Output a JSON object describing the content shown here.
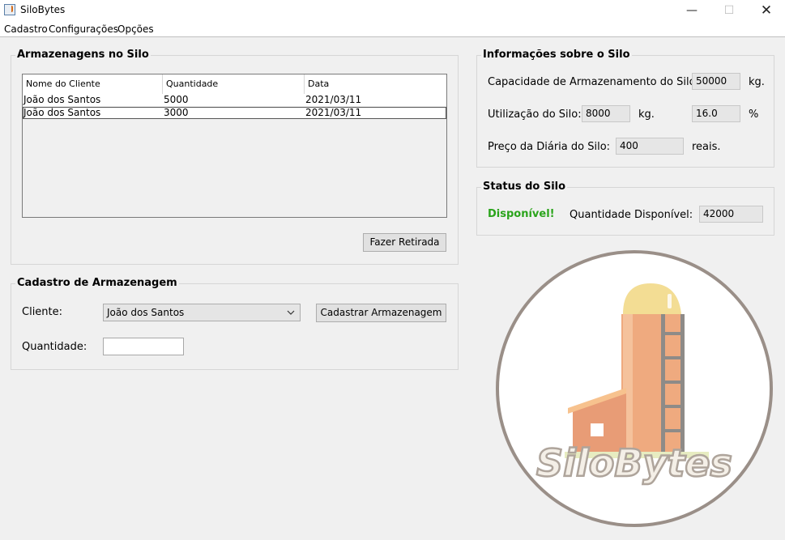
{
  "window": {
    "title": "SiloBytes",
    "minimize": "—",
    "maximize": "☐",
    "close": "✕"
  },
  "menu": [
    "Cadastro",
    "Configurações",
    "Opções"
  ],
  "storage_panel": {
    "title": "Armazenagens no Silo",
    "columns": [
      "Nome do Cliente",
      "Quantidade",
      "Data"
    ],
    "rows": [
      [
        "João dos Santos",
        "5000",
        "2021/03/11"
      ],
      [
        "João dos Santos",
        "3000",
        "2021/03/11"
      ]
    ],
    "withdraw_button": "Fazer Retirada"
  },
  "register_panel": {
    "title": "Cadastro de Armazenagem",
    "client_label": "Cliente:",
    "client_selected": "João dos Santos",
    "register_button": "Cadastrar Armazenagem",
    "quantity_label": "Quantidade:",
    "quantity_value": ""
  },
  "info_panel": {
    "title": "Informações sobre o Silo",
    "capacity_label": "Capacidade de Armazenamento do Silo:",
    "capacity_value": "50000",
    "capacity_unit": "kg.",
    "usage_label": "Utilização do Silo:",
    "usage_value": "8000",
    "usage_unit": "kg.",
    "usage_percent": "16.0",
    "percent_sign": "%",
    "price_label": "Preço da Diária do Silo:",
    "price_value": "400",
    "price_unit": "reais."
  },
  "status_panel": {
    "title": "Status do Silo",
    "status_text": "Disponível!",
    "status_color": "#2aa41b",
    "available_label": "Quantidade Disponível:",
    "available_value": "42000"
  },
  "logo": {
    "text": "SiloBytes"
  }
}
